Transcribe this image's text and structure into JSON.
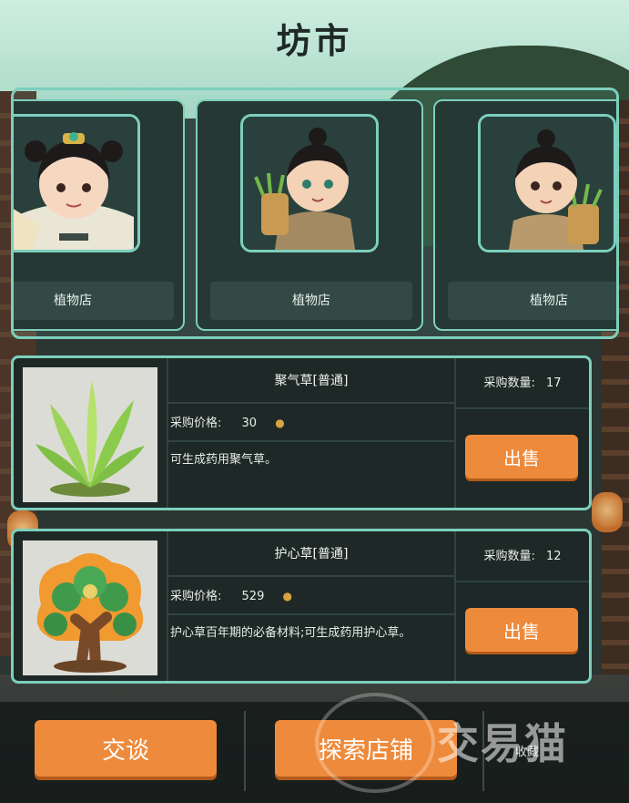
{
  "title": "坊市",
  "shops": [
    {
      "name": "植物店",
      "portrait": "noble-fan-character"
    },
    {
      "name": "植物店",
      "portrait": "herb-gatherer-boy"
    },
    {
      "name": "植物店",
      "portrait": "herb-basket-boy"
    }
  ],
  "items": [
    {
      "name": "聚气草[普通]",
      "price_label": "采购价格:",
      "price": "30",
      "description": "可生成药用聚气草。",
      "qty_label": "采购数量:",
      "qty": "17",
      "sell_label": "出售",
      "image": "leafy-herb-icon"
    },
    {
      "name": "护心草[普通]",
      "price_label": "采购价格:",
      "price": "529",
      "description": "护心草百年期的必备材料;可生成药用护心草。",
      "qty_label": "采购数量:",
      "qty": "12",
      "sell_label": "出售",
      "image": "clover-tree-icon"
    }
  ],
  "bottom": {
    "talk_label": "交谈",
    "explore_label": "探索店铺",
    "collect_label": "收藏"
  },
  "watermark": "交易猫",
  "colors": {
    "accent": "#ee8a3b",
    "border": "#7ccfbd",
    "panel": "#1e2826"
  }
}
